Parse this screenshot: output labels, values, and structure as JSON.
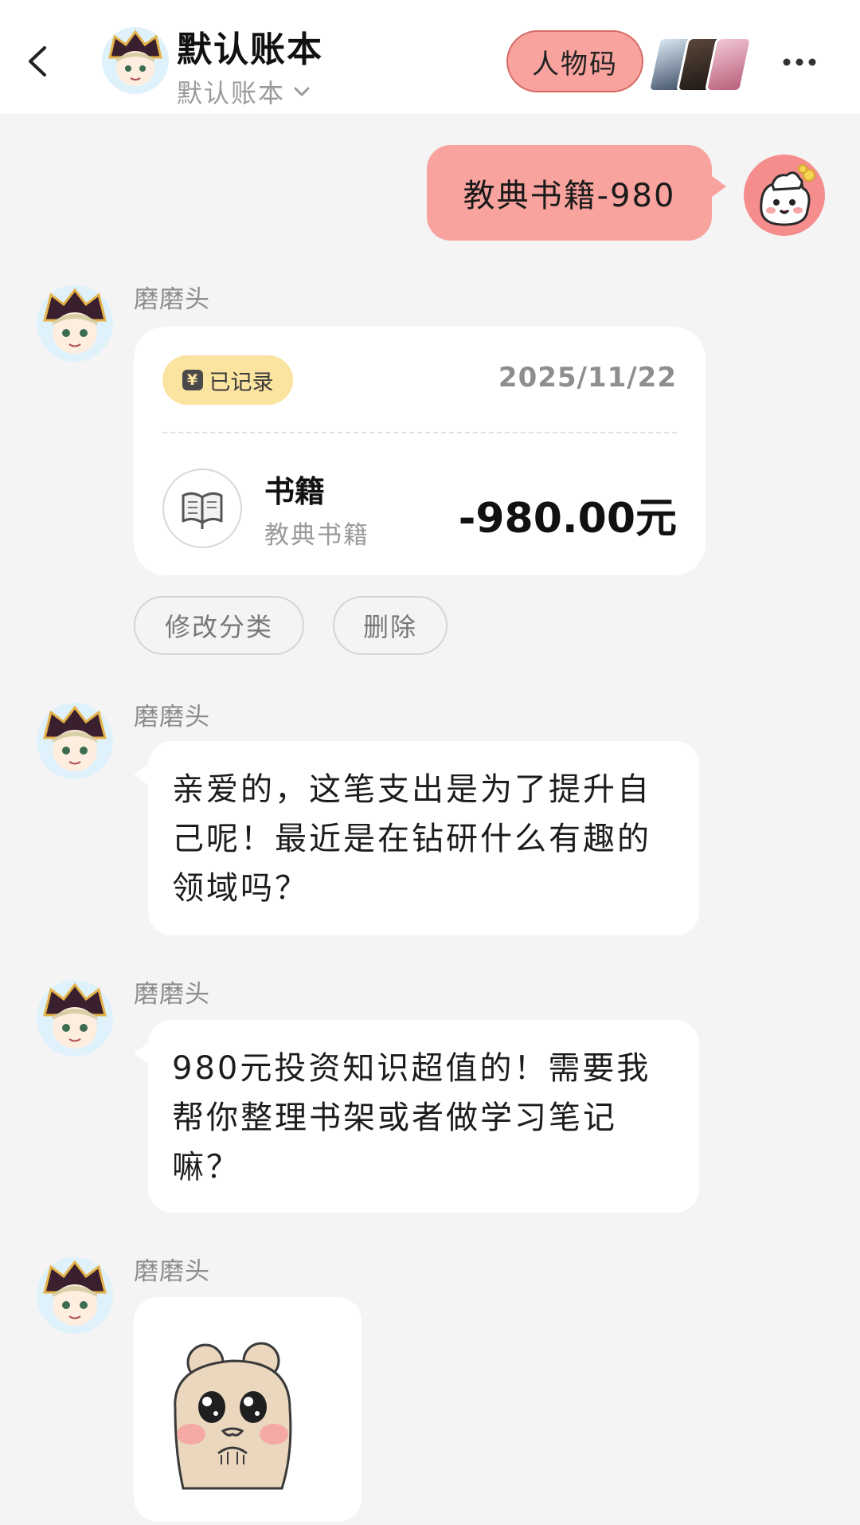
{
  "header": {
    "title": "默认账本",
    "subtitle": "默认账本",
    "character_code_label": "人物码"
  },
  "user_message": {
    "text": "教典书籍-980"
  },
  "record_message": {
    "sender": "磨磨头",
    "badge_label": "已记录",
    "date": "2025/11/22",
    "category": "书籍",
    "note": "教典书籍",
    "amount": "-980.00元",
    "actions": {
      "edit_category": "修改分类",
      "delete": "删除"
    }
  },
  "bot_messages": [
    {
      "sender": "磨磨头",
      "text": "亲爱的，这笔支出是为了提升自己呢！最近是在钻研什么有趣的领域吗？"
    },
    {
      "sender": "磨磨头",
      "text": "980元投资知识超值的！需要我帮你整理书架或者做学习笔记嘛？"
    }
  ],
  "sticker_message": {
    "sender": "磨磨头"
  },
  "colors": {
    "background": "#f4f4f4",
    "accent_pink": "#f8a39e",
    "badge_yellow": "#fbe3a0"
  },
  "icons": {
    "back": "chevron-left-icon",
    "dropdown": "chevron-down-icon",
    "more": "more-dots-icon",
    "category": "open-book-icon",
    "badge": "yen-icon"
  }
}
